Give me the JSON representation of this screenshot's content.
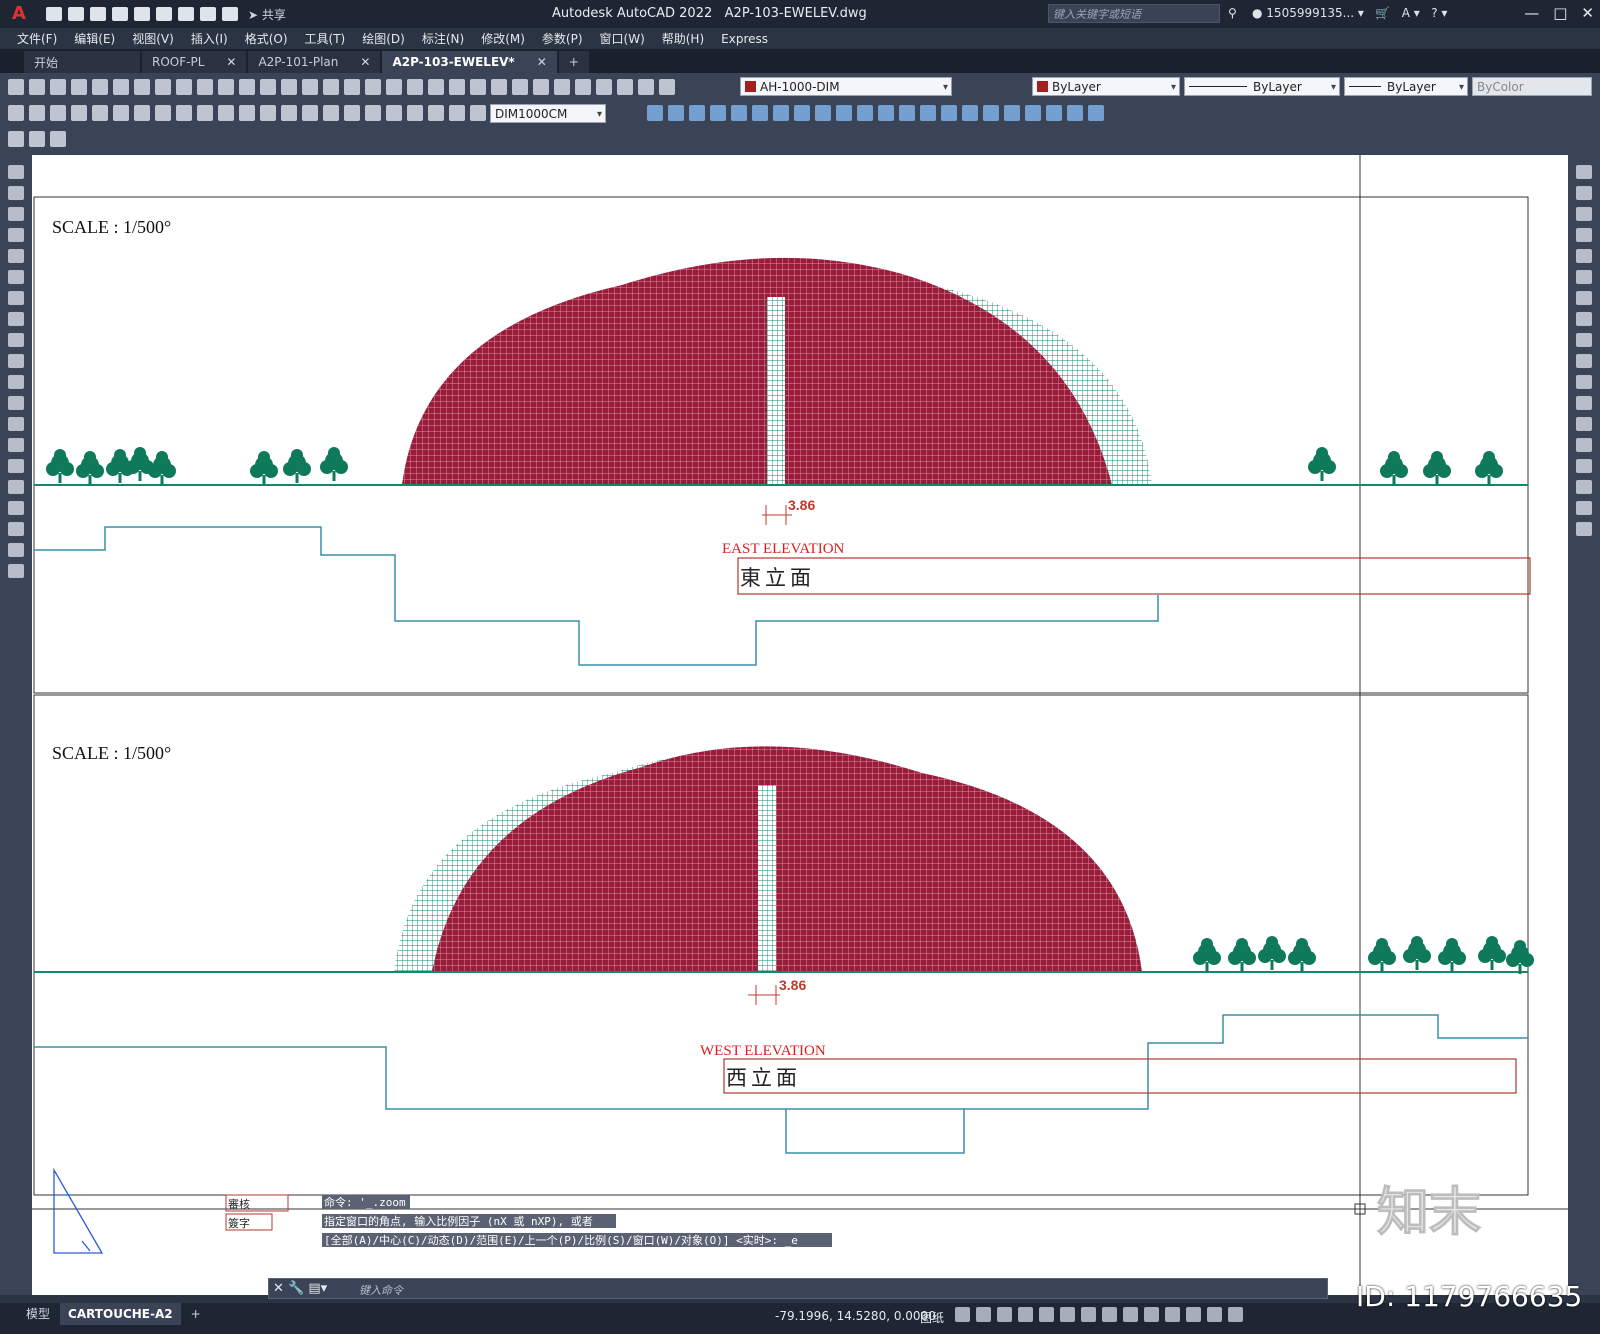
{
  "app": {
    "logo": "A",
    "title": "Autodesk AutoCAD 2022",
    "filename": "A2P-103-EWELEV.dwg",
    "share_label": "共享",
    "search_placeholder": "键入关键字或短语",
    "user": "1505999135..."
  },
  "menu": [
    "文件(F)",
    "编辑(E)",
    "视图(V)",
    "插入(I)",
    "格式(O)",
    "工具(T)",
    "绘图(D)",
    "标注(N)",
    "修改(M)",
    "参数(P)",
    "窗口(W)",
    "帮助(H)",
    "Express"
  ],
  "tabs": [
    {
      "label": "开始",
      "closable": false,
      "active": false
    },
    {
      "label": "ROOF-PL",
      "closable": true,
      "active": false
    },
    {
      "label": "A2P-101-Plan",
      "closable": true,
      "active": false
    },
    {
      "label": "A2P-103-EWELEV*",
      "closable": true,
      "active": true
    }
  ],
  "toolbar": {
    "layer": "AH-1000-DIM",
    "layer_color": "#a32020",
    "color": "ByLayer",
    "linetype": "ByLayer",
    "lineweight": "ByLayer",
    "plotstyle": "ByColor",
    "dimstyle": "DIM1000CM"
  },
  "drawing": {
    "east": {
      "scale": "SCALE : 1/500°",
      "dim": "3.86",
      "title_en": "EAST ELEVATION",
      "title_cn": "東立面"
    },
    "west": {
      "scale": "SCALE : 1/500°",
      "dim": "3.86",
      "title_en": "WEST ELEVATION",
      "title_cn": "西立面"
    },
    "stamp_review": "審核",
    "stamp_sign": "簽字",
    "colors": {
      "dome": "#9b1b3b",
      "green": "#0f8a6b",
      "tree": "#0f7a5a",
      "blueline": "#3c8fa8",
      "red": "#c0392b"
    }
  },
  "command_history": [
    "命令: '_.zoom",
    "指定窗口的角点, 输入比例因子 (nX 或 nXP), 或者",
    "[全部(A)/中心(C)/动态(D)/范围(E)/上一个(P)/比例(S)/窗口(W)/对象(O)] <实时>: _e"
  ],
  "command_placeholder": "键入命令",
  "layout_tabs": [
    "模型",
    "CARTOUCHE-A2"
  ],
  "status": {
    "coords": "-79.1996, 14.5280, 0.0000",
    "space": "图纸"
  },
  "watermark": {
    "brand": "知末",
    "id": "ID: 1179766635"
  }
}
